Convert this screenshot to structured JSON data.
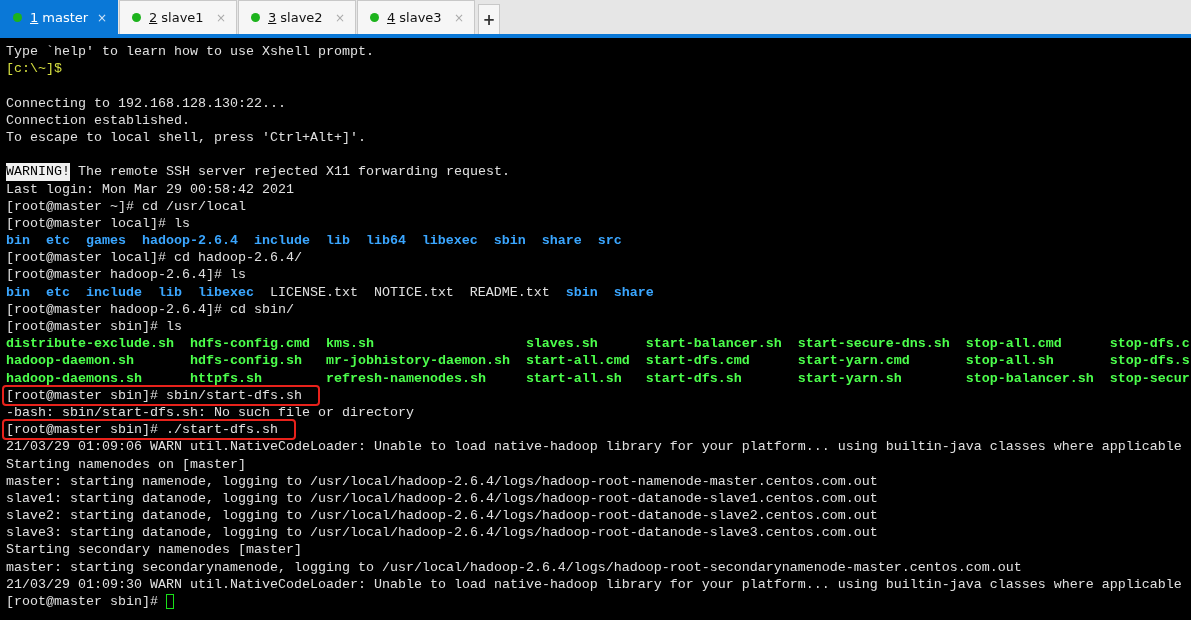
{
  "tabs": [
    {
      "number": "1",
      "label": "master",
      "selected": true,
      "close": "×"
    },
    {
      "number": "2",
      "label": "slave1",
      "selected": false,
      "close": "×"
    },
    {
      "number": "3",
      "label": "slave2",
      "selected": false,
      "close": "×"
    },
    {
      "number": "4",
      "label": "slave3",
      "selected": false,
      "close": "×"
    }
  ],
  "new_tab": "+",
  "terminal": {
    "lines": [
      {
        "kind": "text",
        "boxed": false,
        "segments": [
          {
            "kind": "plain",
            "text": "Type `help' to learn how to use Xshell prompt."
          }
        ]
      },
      {
        "kind": "text",
        "boxed": false,
        "segments": [
          {
            "kind": "local_prompt",
            "text": "[c:\\~]$"
          }
        ]
      },
      {
        "kind": "blank"
      },
      {
        "kind": "text",
        "boxed": false,
        "segments": [
          {
            "kind": "plain",
            "text": "Connecting to 192.168.128.130:22..."
          }
        ]
      },
      {
        "kind": "text",
        "boxed": false,
        "segments": [
          {
            "kind": "plain",
            "text": "Connection established."
          }
        ]
      },
      {
        "kind": "text",
        "boxed": false,
        "segments": [
          {
            "kind": "plain",
            "text": "To escape to local shell, press 'Ctrl+Alt+]'."
          }
        ]
      },
      {
        "kind": "blank"
      },
      {
        "kind": "text",
        "boxed": false,
        "segments": [
          {
            "kind": "inverse",
            "text": "WARNING!"
          },
          {
            "kind": "plain",
            "text": "The remote SSH server rejected X11 forwarding request."
          }
        ]
      },
      {
        "kind": "text",
        "boxed": false,
        "segments": [
          {
            "kind": "plain",
            "text": "Last login: Mon Mar 29 00:58:42 2021"
          }
        ]
      },
      {
        "kind": "text",
        "boxed": false,
        "segments": [
          {
            "kind": "plain",
            "text": "[root@master ~]# cd /usr/local"
          }
        ]
      },
      {
        "kind": "text",
        "boxed": false,
        "segments": [
          {
            "kind": "plain",
            "text": "[root@master local]# ls"
          }
        ]
      },
      {
        "kind": "files",
        "items": [
          {
            "kind": "dir",
            "text": "bin"
          },
          {
            "kind": "dir",
            "text": "etc"
          },
          {
            "kind": "dir",
            "text": "games"
          },
          {
            "kind": "dir",
            "text": "hadoop-2.6.4"
          },
          {
            "kind": "dir",
            "text": "include"
          },
          {
            "kind": "dir",
            "text": "lib"
          },
          {
            "kind": "dir",
            "text": "lib64"
          },
          {
            "kind": "dir",
            "text": "libexec"
          },
          {
            "kind": "dir",
            "text": "sbin"
          },
          {
            "kind": "dir",
            "text": "share"
          },
          {
            "kind": "dir",
            "text": "src"
          }
        ]
      },
      {
        "kind": "text",
        "boxed": false,
        "segments": [
          {
            "kind": "plain",
            "text": "[root@master local]# cd hadoop-2.6.4/"
          }
        ]
      },
      {
        "kind": "text",
        "boxed": false,
        "segments": [
          {
            "kind": "plain",
            "text": "[root@master hadoop-2.6.4]# ls"
          }
        ]
      },
      {
        "kind": "files",
        "items": [
          {
            "kind": "dir",
            "text": "bin"
          },
          {
            "kind": "dir",
            "text": "etc"
          },
          {
            "kind": "dir",
            "text": "include"
          },
          {
            "kind": "dir",
            "text": "lib"
          },
          {
            "kind": "dir",
            "text": "libexec"
          },
          {
            "kind": "file",
            "text": "LICENSE.txt"
          },
          {
            "kind": "file",
            "text": "NOTICE.txt"
          },
          {
            "kind": "file",
            "text": "README.txt"
          },
          {
            "kind": "dir",
            "text": "sbin"
          },
          {
            "kind": "dir",
            "text": "share"
          }
        ]
      },
      {
        "kind": "text",
        "boxed": false,
        "segments": [
          {
            "kind": "plain",
            "text": "[root@master hadoop-2.6.4]# cd sbin/"
          }
        ]
      },
      {
        "kind": "text",
        "boxed": false,
        "segments": [
          {
            "kind": "plain",
            "text": "[root@master sbin]# ls"
          }
        ]
      },
      {
        "kind": "listing",
        "rows": [
          [
            "distribute-exclude.sh",
            "hdfs-config.cmd",
            "kms.sh",
            "slaves.sh",
            "start-balancer.sh",
            "start-secure-dns.sh",
            "stop-all.cmd",
            "stop-dfs.c"
          ],
          [
            "hadoop-daemon.sh",
            "hdfs-config.sh",
            "mr-jobhistory-daemon.sh",
            "start-all.cmd",
            "start-dfs.cmd",
            "start-yarn.cmd",
            "stop-all.sh",
            "stop-dfs.s"
          ],
          [
            "hadoop-daemons.sh",
            "httpfs.sh",
            "refresh-namenodes.sh",
            "start-all.sh",
            "start-dfs.sh",
            "start-yarn.sh",
            "stop-balancer.sh",
            "stop-secur"
          ]
        ]
      },
      {
        "kind": "text",
        "boxed": true,
        "segments": [
          {
            "kind": "plain",
            "text": "[root@master sbin]# sbin/start-dfs.sh"
          }
        ]
      },
      {
        "kind": "text",
        "boxed": false,
        "segments": [
          {
            "kind": "plain",
            "text": "-bash: sbin/start-dfs.sh: No such file or directory"
          }
        ]
      },
      {
        "kind": "text",
        "boxed": true,
        "segments": [
          {
            "kind": "plain",
            "text": "[root@master sbin]# ./start-dfs.sh"
          }
        ]
      },
      {
        "kind": "text",
        "boxed": false,
        "segments": [
          {
            "kind": "plain",
            "text": "21/03/29 01:09:06 WARN util.NativeCodeLoader: Unable to load native-hadoop library for your platform... using builtin-java classes where applicable"
          }
        ]
      },
      {
        "kind": "text",
        "boxed": false,
        "segments": [
          {
            "kind": "plain",
            "text": "Starting namenodes on [master]"
          }
        ]
      },
      {
        "kind": "text",
        "boxed": false,
        "segments": [
          {
            "kind": "plain",
            "text": "master: starting namenode, logging to /usr/local/hadoop-2.6.4/logs/hadoop-root-namenode-master.centos.com.out"
          }
        ]
      },
      {
        "kind": "text",
        "boxed": false,
        "segments": [
          {
            "kind": "plain",
            "text": "slave1: starting datanode, logging to /usr/local/hadoop-2.6.4/logs/hadoop-root-datanode-slave1.centos.com.out"
          }
        ]
      },
      {
        "kind": "text",
        "boxed": false,
        "segments": [
          {
            "kind": "plain",
            "text": "slave2: starting datanode, logging to /usr/local/hadoop-2.6.4/logs/hadoop-root-datanode-slave2.centos.com.out"
          }
        ]
      },
      {
        "kind": "text",
        "boxed": false,
        "segments": [
          {
            "kind": "plain",
            "text": "slave3: starting datanode, logging to /usr/local/hadoop-2.6.4/logs/hadoop-root-datanode-slave3.centos.com.out"
          }
        ]
      },
      {
        "kind": "text",
        "boxed": false,
        "segments": [
          {
            "kind": "plain",
            "text": "Starting secondary namenodes [master]"
          }
        ]
      },
      {
        "kind": "text",
        "boxed": false,
        "segments": [
          {
            "kind": "plain",
            "text": "master: starting secondarynamenode, logging to /usr/local/hadoop-2.6.4/logs/hadoop-root-secondarynamenode-master.centos.com.out"
          }
        ]
      },
      {
        "kind": "text",
        "boxed": false,
        "segments": [
          {
            "kind": "plain",
            "text": "21/03/29 01:09:30 WARN util.NativeCodeLoader: Unable to load native-hadoop library for your platform... using builtin-java classes where applicable"
          }
        ]
      },
      {
        "kind": "text",
        "boxed": false,
        "segments": [
          {
            "kind": "plain",
            "text": "[root@master sbin]#"
          },
          {
            "kind": "cursor"
          }
        ]
      }
    ]
  }
}
